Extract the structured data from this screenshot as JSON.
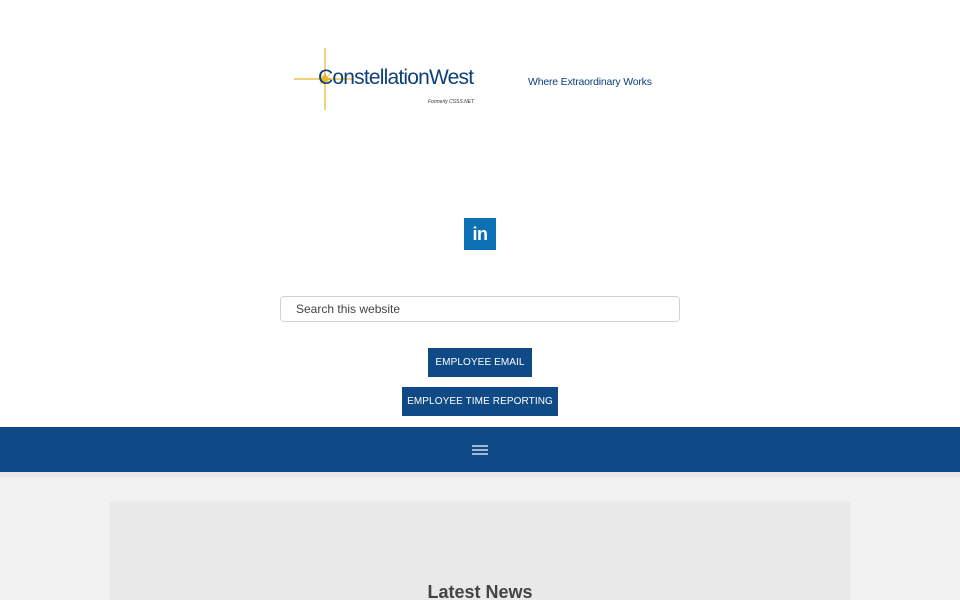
{
  "brand": {
    "name_part1": "Constellation",
    "name_part2": "West",
    "formerly": "Formerly CSSS.NET",
    "tagline": "Where Extraordinary Works"
  },
  "social": {
    "linkedin_label": "in"
  },
  "search": {
    "placeholder": "Search this website"
  },
  "buttons": {
    "employee_email": "EMPLOYEE EMAIL",
    "employee_time_reporting": "EMPLOYEE TIME REPORTING"
  },
  "content": {
    "section_title": "Latest News"
  },
  "colors": {
    "brand_blue": "#0f4a86",
    "linkedin_blue": "#0c72b5",
    "star_gold": "#e8b321"
  },
  "icons": [
    "star-logo-icon",
    "linkedin-icon",
    "menu-icon"
  ]
}
